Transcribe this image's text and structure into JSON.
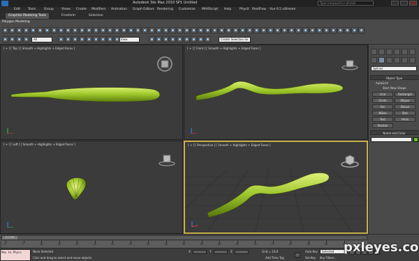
{
  "titlebar": {
    "title": "Autodesk 3ds Max 2010 SP1        Untitled",
    "search_placeholder": "Type a keyword or phrase"
  },
  "menubar": {
    "items": [
      "Edit",
      "Tools",
      "Group",
      "Views",
      "Create",
      "Modifiers",
      "Animation",
      "Graph Editors",
      "Rendering",
      "Customize",
      "MAXScript",
      "Help",
      "PhysX",
      "RealFlow",
      "Vue 6.5 xStream"
    ]
  },
  "ribbon": {
    "tabs": [
      "Graphite Modeling Tools",
      "Freeform",
      "Selection"
    ],
    "active_tab": 0,
    "subtab": "Polygon Modeling"
  },
  "toolbar": {
    "selection_filter": "All",
    "reference_coord": "View",
    "named_selection": "Create Selection Se"
  },
  "viewports": [
    {
      "label": "[ + ] [ Top ] [ Smooth + Highlights + Edged Faces ]"
    },
    {
      "label": "[ + ] [ Front ] [ Smooth + Highlights + Edged Faces ]"
    },
    {
      "label": "[ + ] [ Left ] [ Smooth + Highlights + Edged Faces ]"
    },
    {
      "label": "[ + ] [ Perspective ] [ Smooth + Highlights + Edged Faces ]"
    }
  ],
  "command_panel": {
    "category_dropdown": "Splines",
    "object_type_title": "Object Type",
    "autogrid_label": "AutoGrid",
    "start_new_shape_label": "Start New Shape",
    "buttons": [
      [
        "Line",
        "Rectangle"
      ],
      [
        "Circle",
        "Ellipse"
      ],
      [
        "Arc",
        "Donut"
      ],
      [
        "NGon",
        "Star"
      ],
      [
        "Text",
        "Helix"
      ],
      [
        "Section",
        ""
      ]
    ],
    "name_color_title": "Name and Color",
    "object_color": "#6cc12a"
  },
  "timeline": {
    "slider_label": "0 / 100",
    "ticks": [
      "0",
      "5",
      "10",
      "15",
      "20",
      "25",
      "30",
      "35",
      "40",
      "45",
      "50",
      "55",
      "60",
      "65",
      "70",
      "75",
      "80",
      "85",
      "90",
      "95",
      "100"
    ]
  },
  "statusbar": {
    "maxscript_text": "Max to Physc",
    "selection_status": "None Selected",
    "prompt": "Click and drag to select and move objects",
    "x_value": "X",
    "y_value": "Y",
    "z_value": "Z",
    "grid_text": "Grid = 10,0",
    "add_time_tag": "Add Time Tag",
    "auto_key": "Auto Key",
    "set_key": "Set Key",
    "key_filters": "Key Filters...",
    "key_mode_select": "Selected"
  },
  "watermark": "pxleyes.com",
  "colors": {
    "object_green": "#9cc42a",
    "active_viewport_border": "#c8b04a",
    "viewport_bg": "#3b3b3b"
  }
}
